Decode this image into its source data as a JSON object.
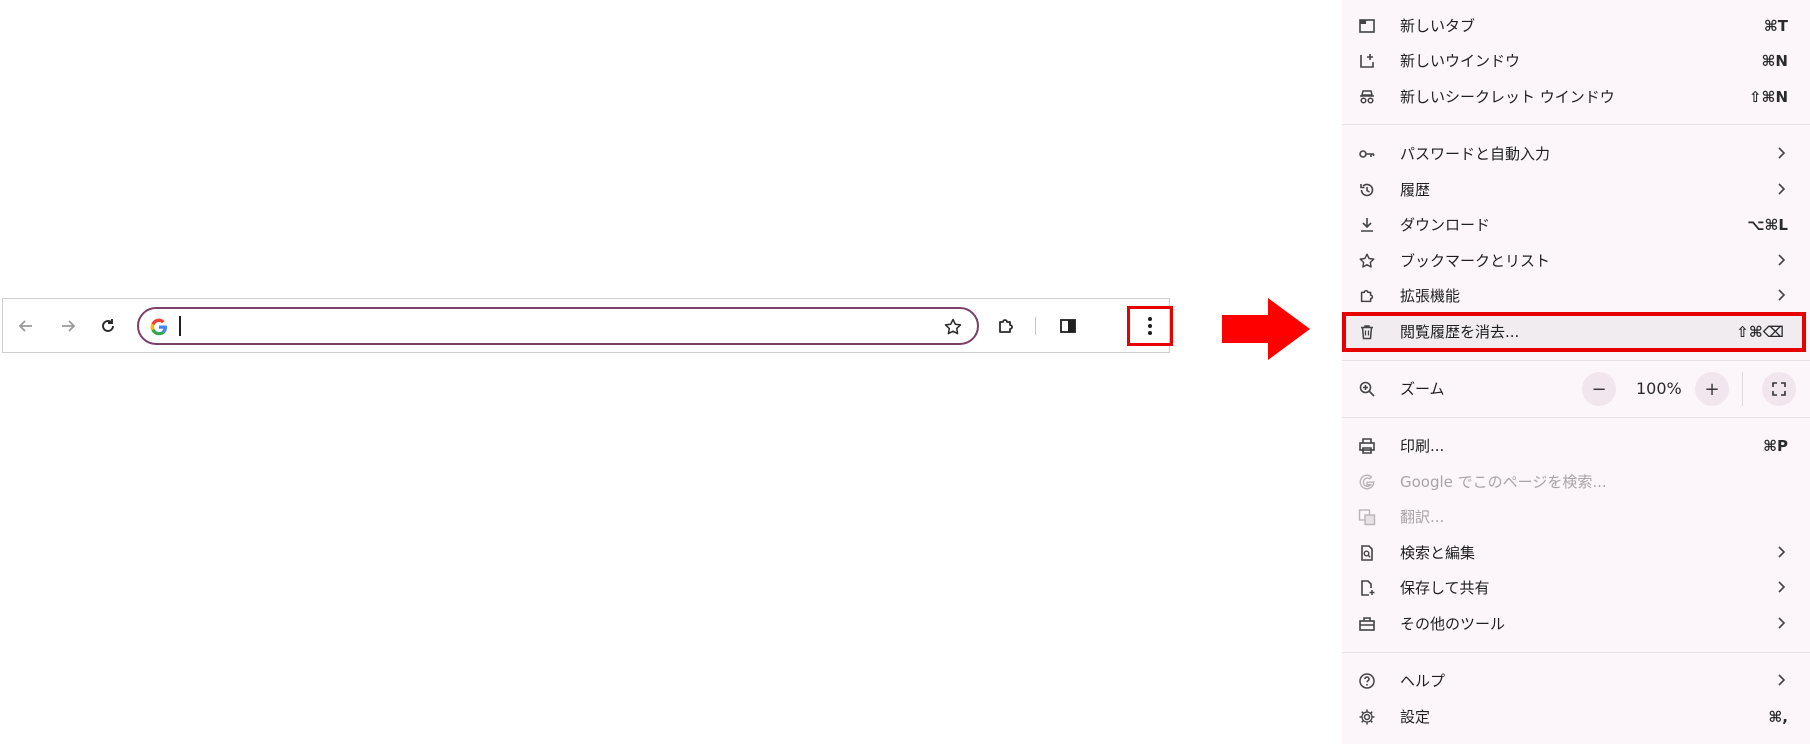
{
  "toolbar": {
    "omnibox_value": "",
    "icons": [
      "back-arrow-icon",
      "forward-arrow-icon",
      "reload-icon",
      "google-g-icon",
      "bookmark-star-icon",
      "extensions-icon",
      "side-panel-icon",
      "more-vert-icon"
    ]
  },
  "menu": {
    "items": [
      {
        "label": "新しいタブ",
        "shortcut": "⌘T",
        "icon": "new-tab-icon"
      },
      {
        "label": "新しいウインドウ",
        "shortcut": "⌘N",
        "icon": "new-window-icon"
      },
      {
        "label": "新しいシークレット ウインドウ",
        "shortcut": "⇧⌘N",
        "icon": "incognito-icon"
      },
      {
        "label": "パスワードと自動入力",
        "icon": "key-icon",
        "submenu": true
      },
      {
        "label": "履歴",
        "icon": "history-icon",
        "submenu": true
      },
      {
        "label": "ダウンロード",
        "shortcut": "⌥⌘L",
        "icon": "download-icon"
      },
      {
        "label": "ブックマークとリスト",
        "icon": "star-icon",
        "submenu": true
      },
      {
        "label": "拡張機能",
        "icon": "extension-icon",
        "submenu": true
      },
      {
        "label": "閲覧履歴を消去...",
        "shortcut": "⇧⌘⌫",
        "icon": "trash-icon"
      },
      {
        "label": "ズーム",
        "icon": "zoom-icon"
      },
      {
        "label": "印刷...",
        "shortcut": "⌘P",
        "icon": "print-icon"
      },
      {
        "label": "Google でこのページを検索...",
        "icon": "google-icon",
        "disabled": true
      },
      {
        "label": "翻訳...",
        "icon": "translate-icon",
        "disabled": true
      },
      {
        "label": "検索と編集",
        "icon": "find-edit-icon",
        "submenu": true
      },
      {
        "label": "保存して共有",
        "icon": "save-share-icon",
        "submenu": true
      },
      {
        "label": "その他のツール",
        "icon": "tools-icon",
        "submenu": true
      },
      {
        "label": "ヘルプ",
        "icon": "help-icon",
        "submenu": true
      },
      {
        "label": "設定",
        "shortcut": "⌘,",
        "icon": "settings-icon"
      }
    ],
    "zoom": {
      "minus": "−",
      "value": "100%",
      "plus": "+",
      "fullscreen_icon": "fullscreen-icon"
    }
  },
  "colors": {
    "highlight_border": "#e60000",
    "omnibox_border": "#7b3f6a",
    "menu_bg": "#fcf6fb",
    "arrow": "#ff0000"
  }
}
